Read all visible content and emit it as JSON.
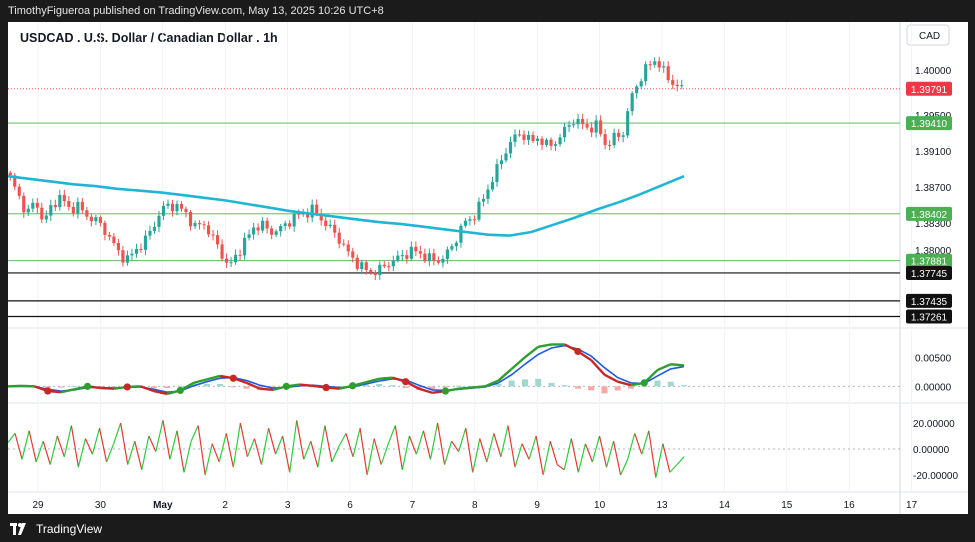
{
  "header": {
    "publisher_line": "TimothyFigueroa published on TradingView.com, May 13, 2025 10:26 UTC+8"
  },
  "chart_title": "USDCAD . U.S. Dollar / Canadian Dollar . 1h",
  "currency_label": "CAD",
  "footer": {
    "brand": "TradingView"
  },
  "colors": {
    "up": "#26a69a",
    "down": "#ef5350",
    "ma": "#1fb6d6",
    "hline": "#4caf50",
    "black_line": "#111111",
    "macd_fast": "#2e9e2e",
    "macd_signal": "#1d5be0",
    "macd_down": "#c62828",
    "osc_up": "#2ecc40",
    "osc_down": "#e53935"
  },
  "chart_data": [
    {
      "type": "candlestick",
      "title": "USDCAD . U.S. Dollar / Canadian Dollar . 1h",
      "x_tick_labels": [
        "29",
        "30",
        "May",
        "2",
        "3",
        "6",
        "7",
        "8",
        "9",
        "10",
        "13",
        "14",
        "15",
        "16",
        "17"
      ],
      "y_tick_labels": [
        "1.40000",
        "1.39500",
        "1.39100",
        "1.38700",
        "1.38300",
        "1.38000"
      ],
      "ylim": [
        1.372,
        1.402
      ],
      "ma_label": "moving average",
      "ma_series": [
        1.3882,
        1.3879,
        1.3876,
        1.3873,
        1.3871,
        1.3868,
        1.3866,
        1.3864,
        1.3861,
        1.3858,
        1.3855,
        1.3851,
        1.3847,
        1.3843,
        1.384,
        1.3837,
        1.3834,
        1.3831,
        1.3829,
        1.3826,
        1.3823,
        1.382,
        1.3817,
        1.3816,
        1.382,
        1.3828,
        1.3836,
        1.3845,
        1.3853,
        1.3862,
        1.3872,
        1.3882
      ],
      "candles_segments": [
        [
          1.388,
          1.386,
          1.384,
          1.3855,
          1.383,
          1.385,
          1.386,
          1.3845,
          1.385,
          1.3838
        ],
        [
          1.3835,
          1.3825,
          1.3812,
          1.3795,
          1.379,
          1.38,
          1.381,
          1.3825,
          1.3845,
          1.385
        ],
        [
          1.3848,
          1.384,
          1.3825,
          1.383,
          1.3815,
          1.38,
          1.378,
          1.3795,
          1.381,
          1.3825,
          1.3828,
          1.382
        ],
        [
          1.3822,
          1.383,
          1.3838,
          1.384,
          1.3845,
          1.3835,
          1.3825,
          1.3815,
          1.38,
          1.3788,
          1.378,
          1.3775
        ],
        [
          1.3778,
          1.3785,
          1.379,
          1.3795,
          1.38,
          1.3795,
          1.379,
          1.3788,
          1.3795,
          1.381,
          1.383
        ],
        [
          1.3835,
          1.385,
          1.387,
          1.389,
          1.391,
          1.3925,
          1.393,
          1.392,
          1.3925,
          1.3915
        ],
        [
          1.392,
          1.3932,
          1.3945,
          1.394,
          1.3935,
          1.3938,
          1.3915,
          1.3925
        ],
        [
          1.393,
          1.397,
          1.399,
          1.4005,
          1.4012,
          1.3995,
          1.3985,
          1.3979
        ]
      ],
      "price_labels": [
        {
          "label": "1.39791",
          "value": 1.39791,
          "bg": "#f23645",
          "line": "dotted-red"
        },
        {
          "label": "1.39410",
          "value": 1.3941,
          "bg": "#4caf50",
          "line": "green"
        },
        {
          "label": "1.38402",
          "value": 1.38402,
          "bg": "#4caf50",
          "line": "green"
        },
        {
          "label": "1.37881",
          "value": 1.37881,
          "bg": "#4caf50",
          "line": "green"
        },
        {
          "label": "1.37745",
          "value": 1.37745,
          "bg": "#111111",
          "line": "black"
        },
        {
          "label": "1.37435",
          "value": 1.37435,
          "bg": "#111111",
          "line": "black"
        },
        {
          "label": "1.37261",
          "value": 1.37261,
          "bg": "#111111",
          "line": "black"
        }
      ]
    },
    {
      "type": "line",
      "name": "macd",
      "y_tick_labels": [
        "0.00500",
        "0.00000"
      ],
      "ylim": [
        -0.002,
        0.009
      ],
      "fast": [
        0.0,
        0.0001,
        0.0,
        -0.0008,
        -0.001,
        -0.0005,
        0.0,
        -0.0003,
        -0.0004,
        -0.0001,
        0.0,
        -0.0008,
        -0.0013,
        -0.0007,
        0.0006,
        0.0012,
        0.0018,
        0.0014,
        0.0006,
        -0.0004,
        -0.0006,
        0.0,
        0.0003,
        0.0001,
        -0.0002,
        -0.0004,
        0.0001,
        0.0007,
        0.0013,
        0.0015,
        0.0008,
        -0.0004,
        -0.0011,
        -0.0008,
        -0.0004,
        -0.0002,
        0.0,
        0.001,
        0.003,
        0.005,
        0.0068,
        0.0072,
        0.0072,
        0.006,
        0.0045,
        0.002,
        0.0008,
        0.0002,
        0.0006,
        0.0028,
        0.0038,
        0.0036
      ],
      "signal": [
        0.0,
        0.0,
        0.0,
        -0.0005,
        -0.0008,
        -0.0006,
        -0.0002,
        -0.0002,
        -0.0003,
        -0.0002,
        -0.0001,
        -0.0005,
        -0.001,
        -0.0008,
        0.0001,
        0.0008,
        0.0014,
        0.0015,
        0.001,
        0.0002,
        -0.0003,
        -0.0002,
        0.0001,
        0.0002,
        0.0,
        -0.0002,
        -0.0001,
        0.0004,
        0.0009,
        0.0013,
        0.0011,
        0.0002,
        -0.0006,
        -0.0007,
        -0.0005,
        -0.0003,
        -0.0001,
        0.0006,
        0.002,
        0.0038,
        0.0055,
        0.0066,
        0.007,
        0.0064,
        0.0052,
        0.0032,
        0.0015,
        0.0006,
        0.0005,
        0.0018,
        0.003,
        0.0034
      ],
      "hist": [
        0.0,
        0.0001,
        0.0,
        -0.0003,
        -0.0002,
        0.0001,
        0.0002,
        -0.0001,
        -0.0001,
        0.0001,
        0.0001,
        -0.0003,
        -0.0003,
        0.0001,
        0.0005,
        0.0004,
        0.0004,
        -0.0001,
        -0.0004,
        -0.0006,
        -0.0003,
        0.0002,
        0.0002,
        -0.0001,
        -0.0002,
        -0.0002,
        0.0002,
        0.0003,
        0.0004,
        0.0002,
        -0.0003,
        -0.0006,
        -0.0005,
        -0.0001,
        0.0001,
        0.0001,
        0.0001,
        0.0004,
        0.001,
        0.0012,
        0.0013,
        0.0006,
        0.0002,
        -0.0004,
        -0.0007,
        -0.0012,
        -0.0007,
        -0.0004,
        0.0001,
        0.001,
        0.0008,
        0.0002
      ],
      "dots": [
        {
          "i": 3,
          "color": "#c62828"
        },
        {
          "i": 6,
          "color": "#2e9e2e"
        },
        {
          "i": 9,
          "color": "#c62828"
        },
        {
          "i": 13,
          "color": "#2e9e2e"
        },
        {
          "i": 17,
          "color": "#c62828"
        },
        {
          "i": 21,
          "color": "#2e9e2e"
        },
        {
          "i": 24,
          "color": "#c62828"
        },
        {
          "i": 26,
          "color": "#2e9e2e"
        },
        {
          "i": 30,
          "color": "#c62828"
        },
        {
          "i": 33,
          "color": "#2e9e2e"
        },
        {
          "i": 43,
          "color": "#c62828"
        },
        {
          "i": 48,
          "color": "#2e9e2e"
        }
      ]
    },
    {
      "type": "line",
      "name": "oscillator",
      "y_tick_labels": [
        "20.00000",
        "0.00000",
        "-20.00000"
      ],
      "ylim": [
        -30,
        30
      ],
      "values": [
        5,
        12,
        -8,
        14,
        -10,
        6,
        -12,
        10,
        -6,
        18,
        -14,
        8,
        -4,
        16,
        -10,
        4,
        20,
        -12,
        6,
        -16,
        10,
        -2,
        22,
        -8,
        14,
        -18,
        6,
        18,
        -20,
        4,
        -10,
        12,
        -14,
        20,
        -6,
        8,
        -12,
        16,
        -4,
        10,
        -18,
        22,
        -8,
        6,
        -14,
        18,
        -10,
        2,
        12,
        -6,
        16,
        -20,
        8,
        -12,
        4,
        18,
        -16,
        10,
        -4,
        14,
        -8,
        20,
        -12,
        6,
        -2,
        16,
        -18,
        8,
        -10,
        12,
        -6,
        18,
        -14,
        4,
        -8,
        10,
        -20,
        6,
        -12,
        -16,
        8,
        -18,
        4,
        -10,
        10,
        -14,
        6,
        -20,
        -8,
        12,
        -4,
        14,
        -22,
        4,
        -18,
        -12,
        -6
      ]
    }
  ]
}
